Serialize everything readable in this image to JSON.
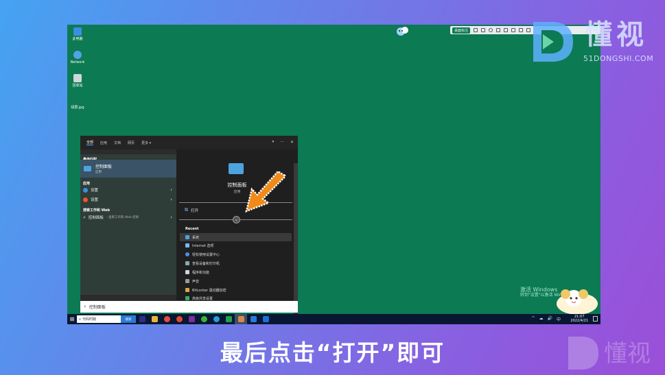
{
  "desktop": {
    "icons": [
      {
        "label": "此电脑",
        "icon": "computer-icon"
      },
      {
        "label": "Network",
        "icon": "network-icon"
      },
      {
        "label": "回收站",
        "icon": "recycle-bin-icon"
      },
      {
        "label": "绿屏.jpg",
        "icon": "image-file-icon"
      }
    ],
    "annotation_toolbar": {
      "pill": "桌面标注"
    },
    "activate_windows": {
      "line1": "激活 Windows",
      "line2": "转到\"设置\"以激活 Windows。"
    }
  },
  "watermark": {
    "text": "懂视",
    "sub": "51DONGSHI.COM"
  },
  "search_panel": {
    "tabs": [
      "全部",
      "应用",
      "文档",
      "网页",
      "更多 ▾"
    ],
    "tab_right": [
      "⏸",
      "···",
      "✕"
    ],
    "best_match_header": "最佳匹配",
    "best_match": {
      "title": "控制面板",
      "sub": "应用"
    },
    "apps_header": "应用",
    "apps": [
      {
        "label": "设置",
        "color": "#3a8ee6"
      },
      {
        "label": "设置",
        "color": "#e8562a"
      }
    ],
    "web_header": "搜索工作和 Web",
    "web_item": {
      "label": "控制面板",
      "sub": " - 查看工作和 Web 结果"
    },
    "detail": {
      "title": "控制面板",
      "sub": "应用",
      "open_label": "打开"
    },
    "recent_header": "Recent",
    "recent": [
      {
        "label": "系统",
        "color": "#4ca3e0"
      },
      {
        "label": "Internet 选项",
        "color": "#7ab8f0"
      },
      {
        "label": "轻松使用设置中心",
        "color": "#4f8de0"
      },
      {
        "label": "查看设备和打印机",
        "color": "#8aa"
      },
      {
        "label": "程序和功能",
        "color": "#c9d6e0"
      },
      {
        "label": "声音",
        "color": "#999"
      },
      {
        "label": "BitLocker 驱动器加密",
        "color": "#d6a84a"
      },
      {
        "label": "高级共享设置",
        "color": "#3aa870"
      }
    ],
    "search_text": "控制面板"
  },
  "taskbar": {
    "search_text": "代码时版",
    "search_btn": "搜索",
    "apps": [
      {
        "name": "premiere-app",
        "color": "#2b2f8a"
      },
      {
        "name": "file-explorer-app",
        "color": "#e8b53a"
      },
      {
        "name": "chrome-app",
        "color": "#e34d3a"
      },
      {
        "name": "wps-app",
        "color": "#e04a2a"
      },
      {
        "name": "premiere-pro-app",
        "color": "#7a2fa0"
      },
      {
        "name": "wechat-app",
        "color": "#3ab53a"
      },
      {
        "name": "edge-app",
        "color": "#2a9ad8"
      },
      {
        "name": "excel-app",
        "color": "#21a34f"
      },
      {
        "name": "settings-app",
        "color": "#d9874a"
      },
      {
        "name": "sticky-app",
        "color": "#2a7ad8"
      },
      {
        "name": "store-app",
        "color": "#1c6fd8"
      }
    ],
    "tray": [
      "^",
      "☁",
      "🔊",
      "中"
    ],
    "time": "21:07",
    "date": "2022/4/21"
  },
  "caption": "最后点击“打开”即可"
}
